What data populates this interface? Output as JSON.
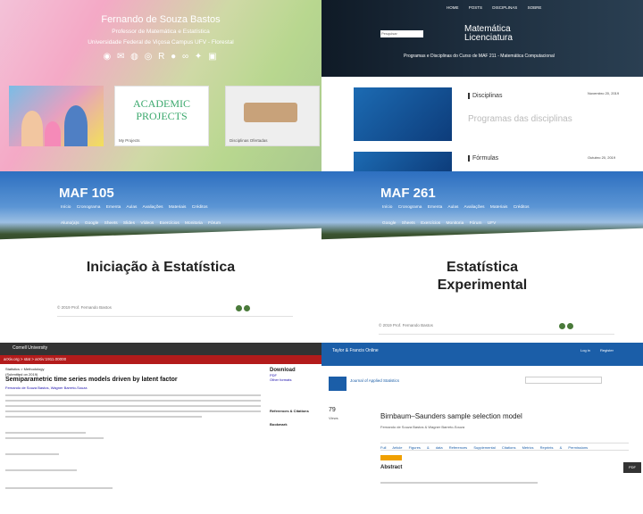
{
  "panel1": {
    "name": "Fernando de Souza Bastos",
    "role": "Professor de Matemática e Estatística",
    "affiliation": "Universidade Federal de Viçosa Campus UFV - Florestal",
    "icons": [
      "whatsapp-icon",
      "email-icon",
      "github-icon",
      "orcid-icon",
      "researchgate-icon",
      "lattes-icon",
      "flickr-icon",
      "twitter-icon",
      "linkedin-icon"
    ],
    "cards": {
      "academic_title": "ACADEMIC PROJECTS",
      "academic_caption": "My Projects",
      "meeting_caption": "Disciplinas Ofertadas"
    }
  },
  "panel2": {
    "nav": [
      "HOME",
      "POSTS",
      "DISCIPLINAS",
      "SOBRE"
    ],
    "search_placeholder": "Pesquisar",
    "title_line1": "Matemática",
    "title_line2": "Licenciatura",
    "tagline": "Programas e Disciplinas do Curso de MAF 211 - Matemática Computacional",
    "items": [
      {
        "label": "Disciplinas",
        "big": "Programas das disciplinas",
        "date": "Novembro 20, 2019"
      },
      {
        "label": "Fórmulas",
        "big": "",
        "date": "Outubro 20, 2019"
      }
    ]
  },
  "panel3": {
    "code": "MAF 105",
    "menu1": "Início Cronograma Ementa Aulas Avaliações Materiais Créditos",
    "menu2": "Aluno(a)s Google Sheets Slides Vídeos Exercícios Monitoria Fórum",
    "title": "Iniciação à Estatística",
    "footer": "© 2019 Prof. Fernando Bastos"
  },
  "panel4": {
    "code": "MAF 261",
    "menu1": "Início Cronograma Ementa Aulas Avaliações Materiais Créditos",
    "menu2": "Google Sheets Exercícios Monitoria Fórum UFV",
    "title_line1": "Estatística",
    "title_line2": "Experimental",
    "footer": "© 2019 Prof. Fernando Bastos"
  },
  "panel5": {
    "site": "Cornell University",
    "red_bar": "arXiv.org > stat > arXiv:1911.00000",
    "category": "Statistics > Methodology",
    "submitted": "(Submitted on 2019)",
    "title": "Semiparametric time series models driven by latent factor",
    "authors": "Fernando de Souza Bastos, Wagner Barreto-Souza",
    "download": "Download",
    "download_items": [
      "PDF",
      "Other formats"
    ],
    "refs": "References & Citations",
    "bookmark": "Bookmark"
  },
  "panel6": {
    "site": "Taylor & Francis Online",
    "journal": "Journal of Applied Statistics",
    "title": "Birnbaum–Saunders sample selection model",
    "authors": "Fernando de Souza Bastos & Wagner Barreto-Souza",
    "tabs": [
      "Full Article",
      "Figures & data",
      "References",
      "Supplemental",
      "Citations",
      "Metrics",
      "Reprints & Permissions"
    ],
    "views": "79",
    "views_label": "Views",
    "abstract": "Abstract",
    "pdf": "PDF",
    "login": "Log in",
    "register": "Register"
  }
}
